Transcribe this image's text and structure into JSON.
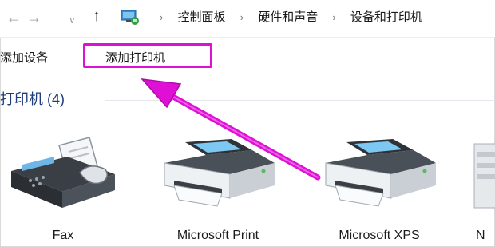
{
  "address_bar": {
    "back_icon": "arrow-left-icon",
    "forward_icon": "arrow-right-icon",
    "recent_icon": "chevron-down-icon",
    "up_icon": "arrow-up-icon",
    "location_icon": "control-panel-icon",
    "breadcrumbs": [
      "控制面板",
      "硬件和声音",
      "设备和打印机"
    ]
  },
  "toolbar": {
    "add_device_label": "添加设备",
    "add_printer_label": "添加打印机"
  },
  "group": {
    "title": "打印机 (4)"
  },
  "devices": [
    {
      "name": "Fax",
      "icon": "fax-icon"
    },
    {
      "name": "Microsoft Print",
      "icon": "printer-icon"
    },
    {
      "name": "Microsoft XPS",
      "icon": "printer-icon"
    },
    {
      "name": "N",
      "icon": "printer-icon"
    }
  ],
  "annotation": {
    "highlight_color": "#e00fd6",
    "arrow_color": "#e00fd6"
  }
}
